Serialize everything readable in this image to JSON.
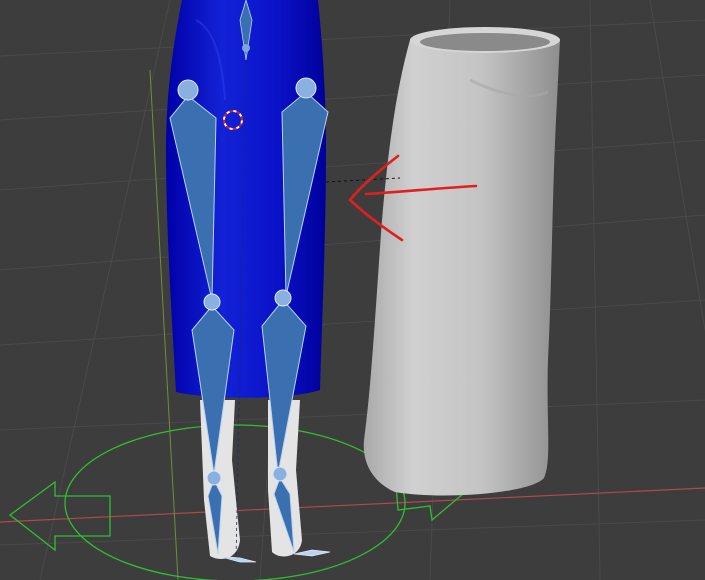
{
  "viewport": {
    "mode": "pose",
    "background_color": "#3d3d3d",
    "grid_color": "#4a4a4a",
    "x_axis_color": "#b04a48",
    "y_axis_color": "#6e8f3a"
  },
  "objects": {
    "rigged_skirt": {
      "color": "#0a12c8",
      "highlight": "#2a3ae0"
    },
    "unrigged_skirt": {
      "color": "#c6c6c6",
      "shade": "#9c9c9c"
    },
    "legs": {
      "color": "#e4e4e4"
    },
    "bones": {
      "fill": "#3a6fb0",
      "outline": "#b9d2f2",
      "joint": "#7fa6d8"
    }
  },
  "annotation": {
    "icon": "arrow-left-icon",
    "color": "#e02020"
  },
  "widgets": {
    "translate_manipulator": {
      "icon": "move-arrows-icon",
      "color": "#2fbf2f"
    },
    "cursor_3d": {
      "icon": "crosshair-icon",
      "color": "#d22222"
    }
  }
}
